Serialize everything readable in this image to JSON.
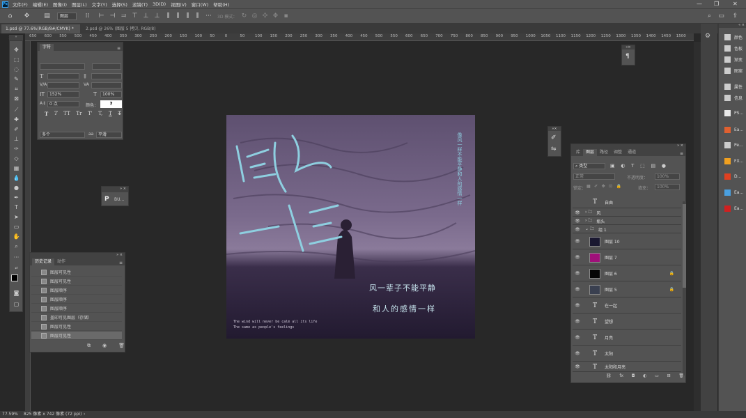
{
  "menubar": {
    "app_logo": "Ps",
    "items": [
      "文件(F)",
      "编辑(E)",
      "图像(I)",
      "图层(L)",
      "文字(Y)",
      "选择(S)",
      "滤镜(T)",
      "3D(D)",
      "视图(V)",
      "窗口(W)",
      "帮助(H)"
    ],
    "window_controls": [
      "—",
      "❐",
      "✕"
    ]
  },
  "options_bar": {
    "auto_select_value": "图层",
    "mode_3d_label": "3D 模式："
  },
  "doc_tabs": [
    {
      "label": "1.psd @ 77.6%(RGB/8#/CMYK) *",
      "close": "×"
    },
    {
      "label": "2.psd @ 26% (图层 5 拷贝, RGB/8)",
      "close": "×"
    }
  ],
  "ruler": {
    "labels": [
      "650",
      "600",
      "550",
      "500",
      "450",
      "400",
      "350",
      "300",
      "250",
      "200",
      "150",
      "100",
      "50",
      "0",
      "50",
      "100",
      "150",
      "200",
      "250",
      "300",
      "350",
      "400",
      "450",
      "500",
      "550",
      "600",
      "650",
      "700",
      "750",
      "800",
      "850",
      "900",
      "950",
      "1000",
      "1050",
      "1100",
      "1150",
      "1200",
      "1250",
      "1300",
      "1350",
      "1400",
      "1450",
      "1500"
    ]
  },
  "character_panel": {
    "tab": "字符",
    "tracking": "152%",
    "scale": "100%",
    "baseline": "0 点",
    "color_label": "颜色：",
    "color_value": "?",
    "language": "多个",
    "aa": "平滑",
    "style_buttons": [
      "T",
      "T",
      "TT",
      "Tr",
      "T'",
      "T,",
      "T",
      "T"
    ]
  },
  "bu_panel": {
    "label": "BU..."
  },
  "history_panel": {
    "tabs": [
      "历史记录",
      "动作"
    ],
    "items": [
      "图层可见性",
      "图层可见性",
      "图层顺序",
      "图层顺序",
      "图层顺序",
      "盖印可见图层（存储）",
      "图层可见性",
      "图层可见性"
    ]
  },
  "layers_panel": {
    "tabs": [
      "库",
      "图层",
      "路径",
      "调整",
      "通道"
    ],
    "filter_kind": "类型",
    "blend_mode": "正常",
    "opacity_label": "不透明度：",
    "opacity_value": "100%",
    "lock_label": "锁定：",
    "fill_label": "填充：",
    "fill_value": "100%",
    "layers": [
      {
        "name": "自由",
        "kind": "text",
        "visible": false
      },
      {
        "name": "风",
        "kind": "group",
        "visible": true
      },
      {
        "name": "瓶头",
        "kind": "group",
        "visible": true
      },
      {
        "name": "组 1",
        "kind": "group-open",
        "visible": true
      },
      {
        "name": "图层 10",
        "kind": "image",
        "visible": true,
        "color": "#1a1830"
      },
      {
        "name": "图层 7",
        "kind": "image",
        "visible": true,
        "color": "#a0107a"
      },
      {
        "name": "图层 6",
        "kind": "image",
        "visible": true,
        "color": "#050505",
        "locked": true
      },
      {
        "name": "图层 5",
        "kind": "image",
        "visible": true,
        "color": "#3a4050",
        "locked": true
      },
      {
        "name": "在一起",
        "kind": "text",
        "visible": true
      },
      {
        "name": "望想",
        "kind": "text",
        "visible": true
      },
      {
        "name": "月亮",
        "kind": "text",
        "visible": true
      },
      {
        "name": "太阳",
        "kind": "text",
        "visible": true
      },
      {
        "name": "太阳和月亮",
        "kind": "text",
        "visible": true
      }
    ]
  },
  "right_strip": {
    "items": [
      "颜色",
      "色板",
      "渐变",
      "图案",
      "属性",
      "信息",
      "PS...",
      "Ea...",
      "Pe...",
      "FX...",
      "D...",
      "Ea...",
      "Ea..."
    ]
  },
  "artwork": {
    "title": "像风一样",
    "line1": "风一辈子不能平静",
    "line2": "和人的感情一样",
    "en1": "The wind will never be calm all its life",
    "en2": "The same as people's feelings",
    "vertical_text": "像风一样不能平静和人的感情一样"
  },
  "status": {
    "zoom": "77.59%",
    "info": "825 像素 x 742 像素 (72 ppi)"
  },
  "colors": {
    "chrome": "#535353",
    "workspace": "#282828",
    "accent": "#31a8ff",
    "art_text": "#8ecfe0"
  }
}
